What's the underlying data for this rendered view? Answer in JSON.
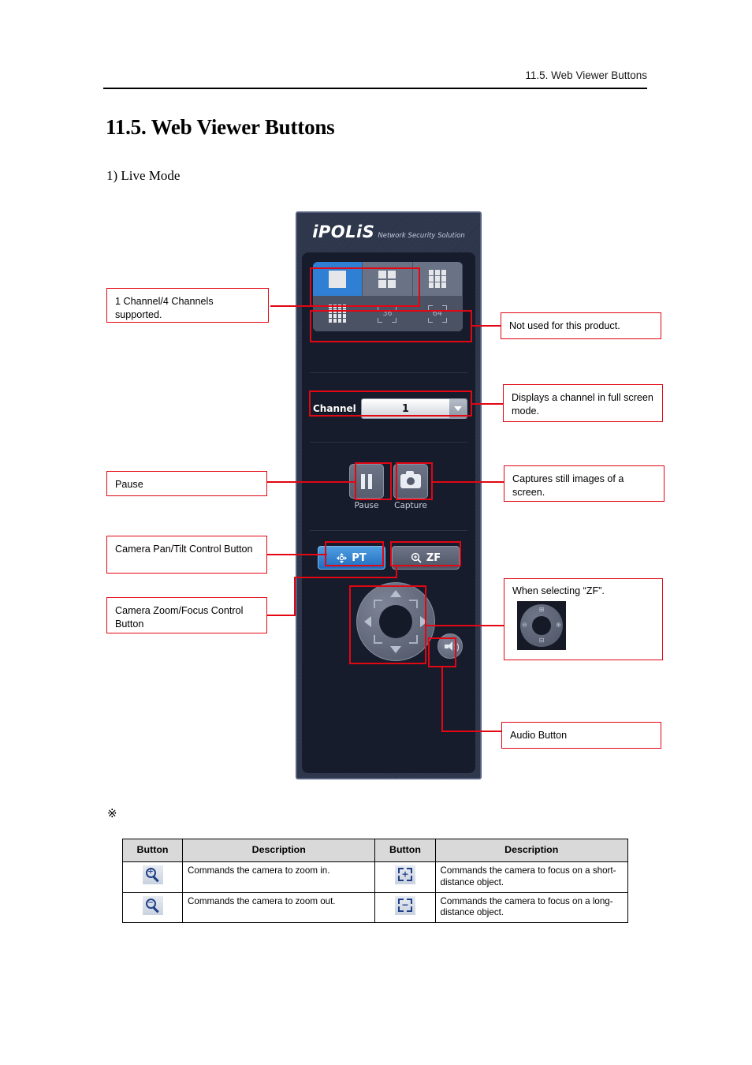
{
  "header": {
    "running_head": "11.5. Web Viewer Buttons"
  },
  "document": {
    "title": "11.5. Web Viewer Buttons",
    "subsection": "1) Live Mode",
    "reference_mark": "※"
  },
  "viewer": {
    "logo_main": "iPOLiS",
    "logo_sub": "Network Security Solution",
    "layout_buttons": [
      {
        "name": "layout-1",
        "label": "1",
        "state": "active"
      },
      {
        "name": "layout-4",
        "label": "4",
        "state": "normal"
      },
      {
        "name": "layout-9",
        "label": "9",
        "state": "normal"
      },
      {
        "name": "layout-16",
        "label": "16",
        "state": "dim"
      },
      {
        "name": "layout-36",
        "label": "36",
        "state": "dim"
      },
      {
        "name": "layout-64",
        "label": "64",
        "state": "dim"
      }
    ],
    "channel": {
      "label": "Channel",
      "value": "1"
    },
    "media": {
      "pause_label": "Pause",
      "capture_label": "Capture"
    },
    "modes": {
      "pt_label": "PT",
      "zf_label": "ZF"
    },
    "audio_icon": "speaker-icon"
  },
  "callouts": {
    "channels_supported": "1 Channel/4 Channels supported.",
    "not_used": "Not used for this product.",
    "full_screen": "Displays a channel in full screen mode.",
    "pause": "Pause",
    "capture": "Captures still images of a screen.",
    "pan_tilt": "Camera Pan/Tilt Control Button",
    "zoom_focus": "Camera Zoom/Focus Control Button",
    "when_zf": "When selecting “ZF”.",
    "audio": "Audio Button"
  },
  "table": {
    "headers": [
      "Button",
      "Description",
      "Button",
      "Description"
    ],
    "rows": [
      {
        "icon_left": "zoom-in-icon",
        "desc_left": "Commands the camera to zoom in.",
        "icon_right": "focus-near-icon",
        "desc_right": "Commands the camera to focus on a short-distance object."
      },
      {
        "icon_left": "zoom-out-icon",
        "desc_left": "Commands the camera to zoom out.",
        "icon_right": "focus-far-icon",
        "desc_right": "Commands the camera to focus on a long-distance object."
      }
    ]
  },
  "colors": {
    "accent_red": "#e30613",
    "panel_bg": "#2b3449",
    "panel_inner": "#161c2b",
    "active_blue": "#2f7fd4"
  }
}
